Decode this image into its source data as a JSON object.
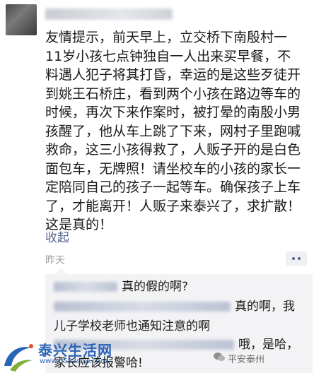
{
  "post": {
    "lines": [
      "友情提示，前天早上，立交桥下南殷村一",
      "11岁小孩七点钟独自一人出来买早餐，不",
      "料遇人犯子将其打昏，幸运的是这些歹徒开",
      "到姚王石桥庄，看到两个小孩在路边等车的",
      "时候，再次下来作案时，被打晕的南殷小男",
      "孩醒了，他从车上跳了下来，网村子里跑喊",
      "救命，这三小孩得救了，人贩子开的是白色",
      "面包车，无牌照！请坐校车的小孩的家长一",
      "定陪同自己的孩子一起等车。确保孩子上车",
      "了，才能离开！人贩子来泰兴了，求扩散！",
      "这是真的！"
    ],
    "collapse_label": "收起",
    "time": "昨天"
  },
  "comments": [
    {
      "text": "真的假的啊?"
    },
    {
      "text": "真的啊，我"
    },
    {
      "text": "儿子学校老师也通知注意的啊"
    },
    {
      "text": "哦，是哈，"
    },
    {
      "text": "家长应该报警哈!"
    }
  ],
  "watermark": {
    "logo_text": "泰兴生活网",
    "logo_url": "www.0523shw.com",
    "right_text": "平安泰州"
  },
  "colors": {
    "link": "#56668f",
    "comment_bg": "#f3f3f5",
    "logo": "#2a64b8"
  }
}
